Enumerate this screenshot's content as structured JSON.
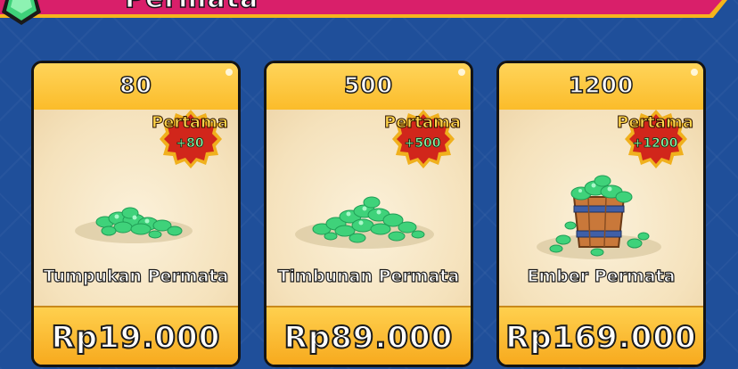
{
  "header": {
    "title": "Permata",
    "icon": "gem-badge-icon",
    "colors": {
      "banner": "#d91f6a",
      "trim": "#f5b51c"
    }
  },
  "offers": [
    {
      "amount": "80",
      "badge_title": "Pertama",
      "badge_bonus": "+80",
      "name": "Tumpukan Permata",
      "price": "Rp19.000",
      "image": "small-gem-pile-icon"
    },
    {
      "amount": "500",
      "badge_title": "Pertama",
      "badge_bonus": "+500",
      "name": "Timbunan Permata",
      "price": "Rp89.000",
      "image": "large-gem-pile-icon"
    },
    {
      "amount": "1200",
      "badge_title": "Pertama",
      "badge_bonus": "+1200",
      "name": "Ember Permata",
      "price": "Rp169.000",
      "image": "gem-bucket-icon"
    }
  ],
  "colors": {
    "background": "#1f4f9a",
    "card_gold": "#fbbc2a",
    "card_cream": "#f7e6c3",
    "badge_red": "#d1261b",
    "badge_text": "#ffd54a",
    "gem_green": "#3fd27a"
  }
}
